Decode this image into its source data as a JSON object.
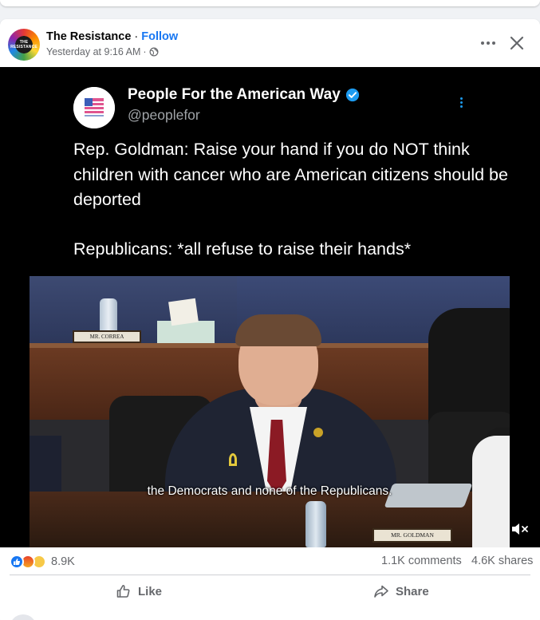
{
  "post": {
    "author": "The Resistance",
    "separator": " · ",
    "follow_label": "Follow",
    "timestamp": "Yesterday at 9:16 AM",
    "meta_separator": "·",
    "avatar_text": "THE RESISTANCE"
  },
  "tweet": {
    "name": "People For the American Way",
    "handle": "@peoplefor",
    "text_line1": "Rep. Goldman: Raise your hand if you do NOT think children with cancer who are American citizens should be deported",
    "text_line2": "Republicans: *all refuse to raise their hands*"
  },
  "video": {
    "caption": "the Democrats and none of the Republicans.",
    "nameplate_left": "MR. CORREA",
    "nameplate_right": "MR. GOLDMAN"
  },
  "stats": {
    "reaction_count": "8.9K",
    "comments": "1.1K comments",
    "shares": "4.6K shares"
  },
  "actions": {
    "like_label": "Like",
    "share_label": "Share"
  },
  "colors": {
    "accent": "#1877f2",
    "secondary_text": "#65676b",
    "verified": "#1d9bf0"
  },
  "icons": [
    "globe-icon",
    "more-icon",
    "close-icon",
    "verified-icon",
    "mute-icon",
    "like-icon",
    "share-icon"
  ]
}
